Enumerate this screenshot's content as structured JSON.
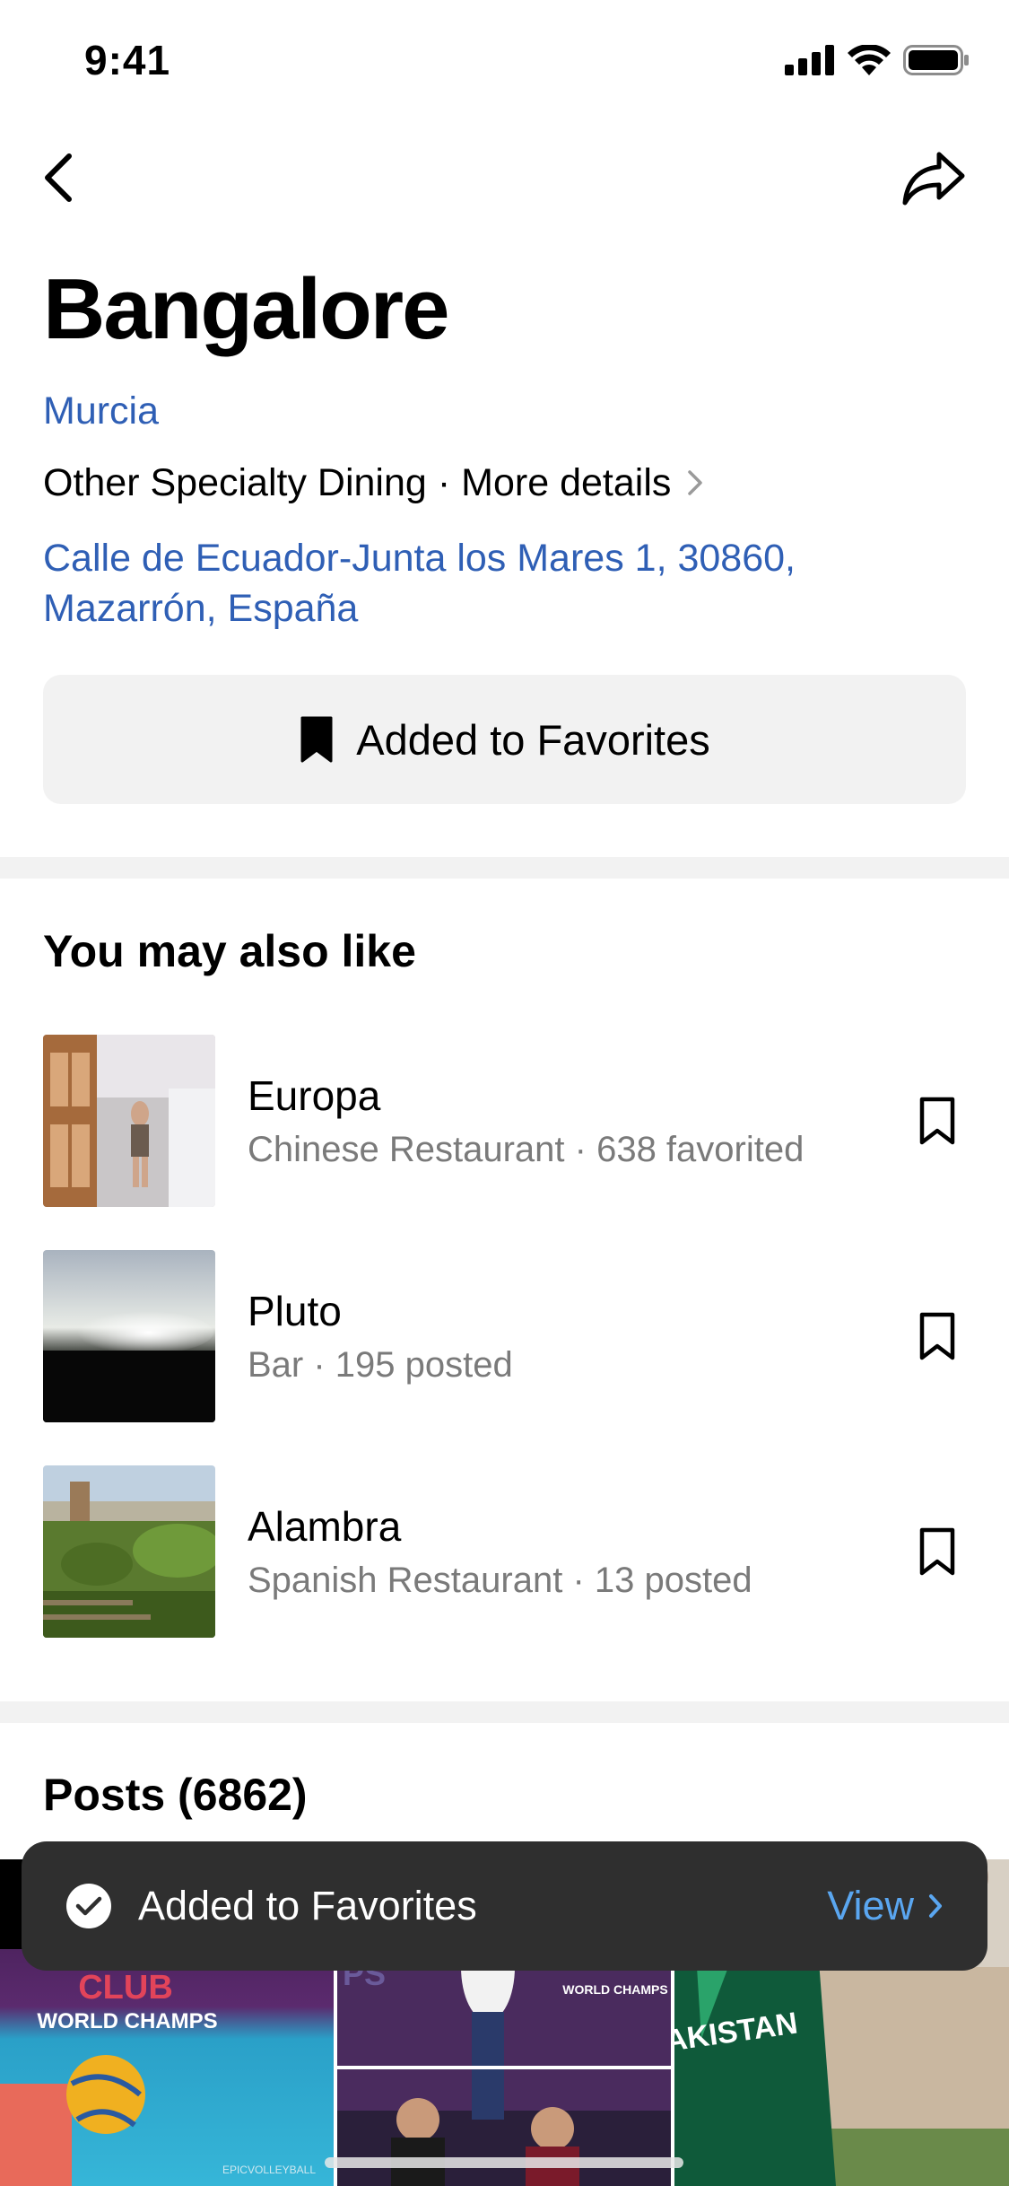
{
  "status_bar": {
    "time": "9:41"
  },
  "place": {
    "title": "Bangalore",
    "city": "Murcia",
    "category": "Other Specialty Dining",
    "separator": "·",
    "more_details": "More details",
    "address": "Calle de Ecuador-Junta los Mares 1, 30860, Mazarrón, España",
    "favorite_button": "Added to Favorites"
  },
  "suggestions": {
    "title": "You may also like",
    "items": [
      {
        "name": "Europa",
        "meta": "Chinese Restaurant · 638 favorited"
      },
      {
        "name": "Pluto",
        "meta": "Bar · 195 posted"
      },
      {
        "name": "Alambra",
        "meta": "Spanish Restaurant · 13 posted"
      }
    ]
  },
  "posts": {
    "title": "Posts (6862)",
    "tiles": [
      {
        "line1": "CLUB",
        "line2": "WORLD CHAMPS",
        "caption": "EPICVOLLEYBALL"
      },
      {
        "line1": "WORLD CHAMPS",
        "line2": "PS"
      },
      {
        "line1": "PAKISTAN"
      }
    ]
  },
  "toast": {
    "text": "Added to Favorites",
    "action": "View"
  },
  "colors": {
    "link": "#2f5fb5",
    "toast_bg": "#2f2f2f",
    "toast_action": "#5aa6f0",
    "muted": "#7a7a7a"
  }
}
